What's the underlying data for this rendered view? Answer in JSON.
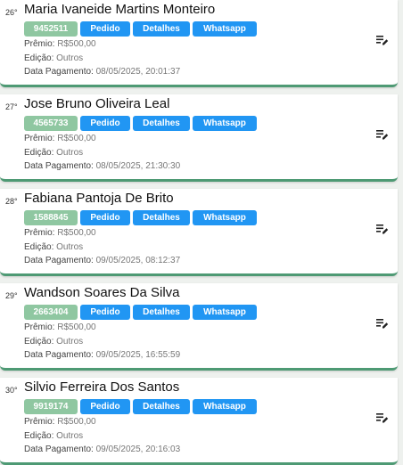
{
  "labels": {
    "premio": "Prêmio:",
    "edicao": "Edição:",
    "data_pagamento": "Data Pagamento:",
    "pedido": "Pedido",
    "detalhes": "Detalhes",
    "whatsapp": "Whatsapp"
  },
  "colors": {
    "code_badge": "#8fc7a1",
    "action_button": "#2196f3",
    "card_accent": "#4e9a74"
  },
  "icons": {
    "menu": "playlist-edit-icon"
  },
  "entries": [
    {
      "rank": "26°",
      "name": "Maria Ivaneide Martins Monteiro",
      "code": "9452511",
      "premio": "R$500,00",
      "edicao": "Outros",
      "data_pagamento": "08/05/2025, 20:01:37"
    },
    {
      "rank": "27°",
      "name": "Jose Bruno Oliveira Leal",
      "code": "4565733",
      "premio": "R$500,00",
      "edicao": "Outros",
      "data_pagamento": "08/05/2025, 21:30:30"
    },
    {
      "rank": "28°",
      "name": "Fabiana Pantoja De Brito",
      "code": "1588845",
      "premio": "R$500,00",
      "edicao": "Outros",
      "data_pagamento": "09/05/2025, 08:12:37"
    },
    {
      "rank": "29°",
      "name": "Wandson Soares Da Silva",
      "code": "2663404",
      "premio": "R$500,00",
      "edicao": "Outros",
      "data_pagamento": "09/05/2025, 16:55:59"
    },
    {
      "rank": "30°",
      "name": "Silvio Ferreira Dos Santos",
      "code": "9919174",
      "premio": "R$500,00",
      "edicao": "Outros",
      "data_pagamento": "09/05/2025, 20:16:03"
    }
  ]
}
